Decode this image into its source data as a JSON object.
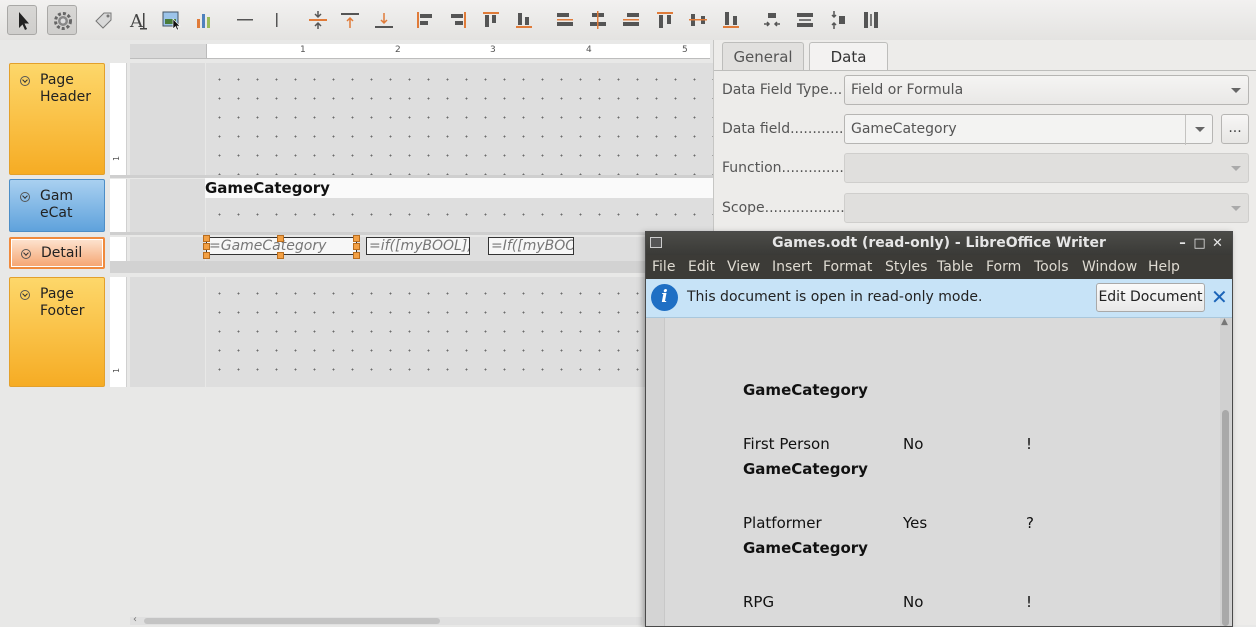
{
  "toolbar": {
    "tools": [
      {
        "name": "select-pointer-icon",
        "pressed": true
      },
      {
        "name": "gear-icon",
        "pressed": true
      },
      {
        "name": "label-tag-icon"
      },
      {
        "name": "text-field-icon"
      },
      {
        "name": "image-icon"
      },
      {
        "name": "chart-icon"
      },
      {
        "name": "horizontal-line-icon"
      },
      {
        "name": "vertical-line-icon"
      },
      {
        "name": "align-center-vertical-icon"
      },
      {
        "name": "align-top-icon"
      },
      {
        "name": "align-bottom-icon"
      },
      {
        "name": "align-left-icon"
      },
      {
        "name": "align-right-icon"
      },
      {
        "name": "align-top-edge-icon"
      },
      {
        "name": "align-bottom-edge-icon"
      },
      {
        "name": "distribute-left-icon"
      },
      {
        "name": "distribute-center-icon"
      },
      {
        "name": "distribute-right-icon"
      },
      {
        "name": "distribute-top-icon"
      },
      {
        "name": "distribute-middle-icon"
      },
      {
        "name": "distribute-bottom-icon"
      },
      {
        "name": "shrink-width-icon"
      },
      {
        "name": "equal-width-icon"
      },
      {
        "name": "shrink-height-icon"
      },
      {
        "name": "equal-height-icon"
      }
    ]
  },
  "designer": {
    "ruler_numbers": [
      "1",
      "2",
      "3",
      "4",
      "5"
    ],
    "vruler_tick": "1",
    "sections": {
      "page_header": "Page Header",
      "group": "GameCat",
      "detail": "Detail",
      "page_footer": "Page Footer"
    },
    "group_header_field": "GameCategory",
    "detail_fields": [
      "=GameCategory",
      "=if([myBOOL];",
      "=If([myBOO"
    ]
  },
  "properties": {
    "tabs": [
      "General",
      "Data"
    ],
    "active_tab": "Data",
    "rows": [
      {
        "label": "Data Field Type...",
        "value": "Field or Formula"
      },
      {
        "label": "Data field............",
        "value": "GameCategory",
        "button": "..."
      },
      {
        "label": "Function..............",
        "value": ""
      },
      {
        "label": "Scope..................",
        "value": ""
      }
    ]
  },
  "writer": {
    "title": "Games.odt (read-only) - LibreOffice Writer",
    "window_buttons": [
      "–",
      "□",
      "✕"
    ],
    "menu": [
      "File",
      "Edit",
      "View",
      "Insert",
      "Format",
      "Styles",
      "Table",
      "Form",
      "Tools",
      "Window",
      "Help"
    ],
    "infobar": {
      "message": "This document is open in read-only mode.",
      "button": "Edit Document",
      "close": "✕"
    },
    "doc": {
      "heading": "GameCategory",
      "rows": [
        {
          "name": "First Person",
          "bool": "No",
          "mark": "!",
          "group": "GameCategory"
        },
        {
          "name": "Platformer",
          "bool": "Yes",
          "mark": "?",
          "group": "GameCategory"
        },
        {
          "name": "RPG",
          "bool": "No",
          "mark": "!"
        }
      ]
    }
  }
}
